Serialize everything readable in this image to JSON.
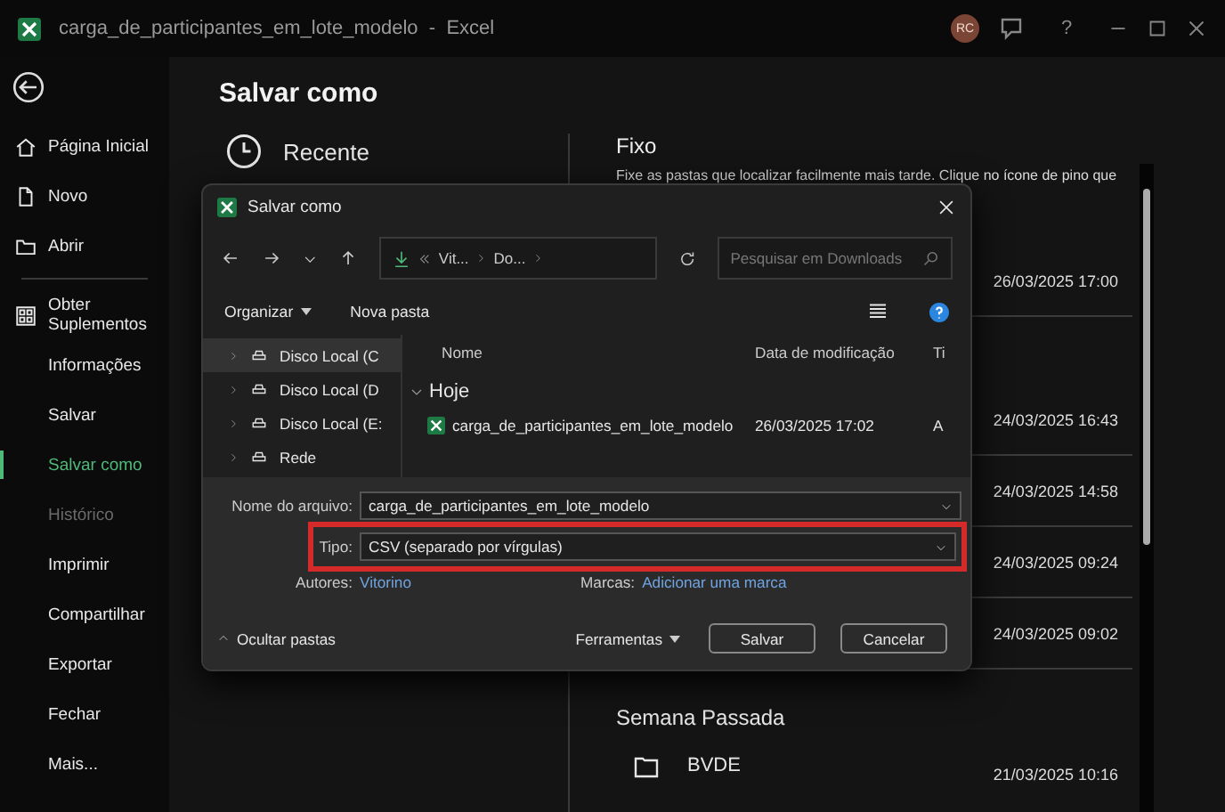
{
  "window": {
    "title": "carga_de_participantes_em_lote_modelo  -  Excel",
    "avatar": "RC",
    "help": "?"
  },
  "sidebar": {
    "items": [
      {
        "label": "Página Inicial",
        "selected": false,
        "disabled": false
      },
      {
        "label": "Novo",
        "selected": false,
        "disabled": false
      },
      {
        "label": "Abrir",
        "selected": false,
        "disabled": false
      },
      {
        "label": "Obter Suplementos",
        "selected": false,
        "disabled": false
      },
      {
        "label": "Informações",
        "selected": false,
        "disabled": false
      },
      {
        "label": "Salvar",
        "selected": false,
        "disabled": false
      },
      {
        "label": "Salvar como",
        "selected": true,
        "disabled": false
      },
      {
        "label": "Histórico",
        "selected": false,
        "disabled": true
      },
      {
        "label": "Imprimir",
        "selected": false,
        "disabled": false
      },
      {
        "label": "Compartilhar",
        "selected": false,
        "disabled": false
      },
      {
        "label": "Exportar",
        "selected": false,
        "disabled": false
      },
      {
        "label": "Fechar",
        "selected": false,
        "disabled": false
      },
      {
        "label": "Mais...",
        "selected": false,
        "disabled": false
      }
    ]
  },
  "page": {
    "title": "Salvar como",
    "locations": [
      {
        "label": "Recente"
      }
    ],
    "pinned": {
      "title": "Fixo",
      "description": "Fixe as pastas que localizar facilmente mais tarde. Clique no ícone de pino que"
    },
    "recent_dates": [
      "26/03/2025 17:00",
      "24/03/2025 16:43",
      "24/03/2025 14:58",
      "24/03/2025 09:24",
      "24/03/2025 09:02"
    ],
    "last_week": {
      "title": "Semana Passada",
      "items": [
        {
          "name": "BVDE",
          "date": "21/03/2025 10:16"
        }
      ]
    }
  },
  "dialog": {
    "title": "Salvar como",
    "breadcrumb": [
      "Vit...",
      "Do..."
    ],
    "search": {
      "placeholder": "Pesquisar em Downloads"
    },
    "toolbar": [
      "Organizar",
      "Nova pasta"
    ],
    "tree": [
      {
        "label": "Disco Local (C",
        "selected": true
      },
      {
        "label": "Disco Local (D",
        "selected": false
      },
      {
        "label": "Disco Local (E:",
        "selected": false
      },
      {
        "label": "Rede",
        "selected": false
      }
    ],
    "columns": [
      "Nome",
      "Data de modificação",
      "Ti"
    ],
    "group": "Hoje",
    "files": [
      {
        "name": "carga_de_participantes_em_lote_modelo",
        "modified": "26/03/2025 17:02",
        "column_3": "A"
      }
    ],
    "filename": {
      "label": "Nome do arquivo:",
      "value": "carga_de_participantes_em_lote_modelo"
    },
    "type": {
      "label": "Tipo:",
      "value": "CSV (separado por vírgulas)",
      "highlighted": true
    },
    "authors": {
      "label": "Autores:",
      "value": "Vitorino"
    },
    "tags": {
      "label": "Marcas:",
      "value": "Adicionar uma marca"
    },
    "hide_folders": "Ocultar pastas",
    "tools": "Ferramentas",
    "buttons": [
      "Salvar",
      "Cancelar"
    ]
  }
}
